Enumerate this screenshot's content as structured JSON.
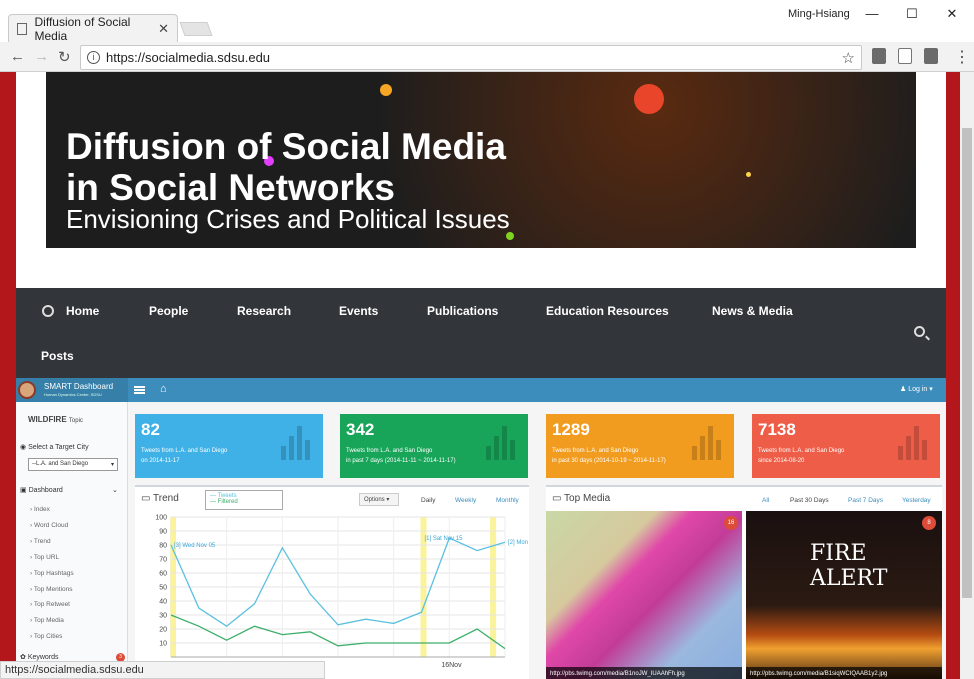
{
  "browser": {
    "tab_title": "Diffusion of Social Media",
    "user": "Ming-Hsiang",
    "url": "https://socialmedia.sdsu.edu",
    "status_url": "https://socialmedia.sdsu.edu"
  },
  "banner": {
    "title_line1": "Diffusion of Social Media",
    "title_line2": "in Social Networks",
    "subtitle": "Envisioning Crises and Political Issues"
  },
  "nav": {
    "items": [
      "Home",
      "People",
      "Research",
      "Events",
      "Publications",
      "Education Resources",
      "News & Media",
      "Posts"
    ]
  },
  "dashboard": {
    "brand": "SMART Dashboard",
    "brand_sub": "Human Dynamics Center, SDSU",
    "login": "Log in",
    "topic_label": "WILDFIRE",
    "topic_suffix": "Topic",
    "city_label": "Select a Target City",
    "city_value": "--L.A. and San Diego",
    "dashboard_label": "Dashboard",
    "menu": [
      "Index",
      "Word Cloud",
      "Trend",
      "Top URL",
      "Top Hashtags",
      "Top Mentions",
      "Top Retweet",
      "Top Media",
      "Top Cities"
    ],
    "keywords_label": "Keywords",
    "keywords_badge": "3",
    "stats": [
      {
        "value": "82",
        "line1": "Tweets from L.A. and San Diego",
        "line2": "on 2014-11-17",
        "color": "#3fb1e6"
      },
      {
        "value": "342",
        "line1": "Tweets from L.A. and San Diego",
        "line2": "in past 7 days (2014-11-11 ~ 2014-11-17)",
        "color": "#18a559"
      },
      {
        "value": "1289",
        "line1": "Tweets from L.A. and San Diego",
        "line2": "in past 30 days (2014-10-19 ~ 2014-11-17)",
        "color": "#f29c1f"
      },
      {
        "value": "7138",
        "line1": "Tweets from L.A. and San Diego",
        "line2": "since 2014-08-20",
        "color": "#ee5d47"
      }
    ],
    "trend": {
      "title": "Trend",
      "legend": [
        "Tweets",
        "Filtered"
      ],
      "options": "Options",
      "tabs": [
        "Daily",
        "Weekly",
        "Monthly"
      ],
      "annotations": [
        "[3] Wed Nov 05",
        "[1] Sat Nov 15",
        "[2] Mon"
      ],
      "x_label": "16Nov"
    },
    "top_media": {
      "title": "Top Media",
      "tabs": [
        "All",
        "Past 30 Days",
        "Past 7 Days",
        "Yesterday"
      ],
      "items": [
        {
          "caption": "http://pbs.twimg.com/media/B1noJW_IUAAhFh.jpg",
          "badge": "16"
        },
        {
          "caption": "http://pbs.twimg.com/media/B1siqWCIQAAB1y2.jpg",
          "badge": "8",
          "image_text": "FIRE ALERT"
        }
      ]
    }
  },
  "chart_data": {
    "type": "line",
    "title": "Trend",
    "x_tick_labels": [
      "16Nov"
    ],
    "y_ticks": [
      10,
      20,
      30,
      40,
      50,
      60,
      70,
      80,
      90,
      100
    ],
    "ylim": [
      0,
      100
    ],
    "series": [
      {
        "name": "Tweets",
        "color": "#5bc0de",
        "values": [
          80,
          35,
          22,
          38,
          78,
          45,
          23,
          27,
          24,
          32,
          85,
          76,
          82
        ]
      },
      {
        "name": "Filtered",
        "color": "#3cae6a",
        "values": [
          30,
          22,
          12,
          22,
          16,
          18,
          8,
          10,
          10,
          10,
          10,
          20,
          6
        ]
      }
    ]
  }
}
